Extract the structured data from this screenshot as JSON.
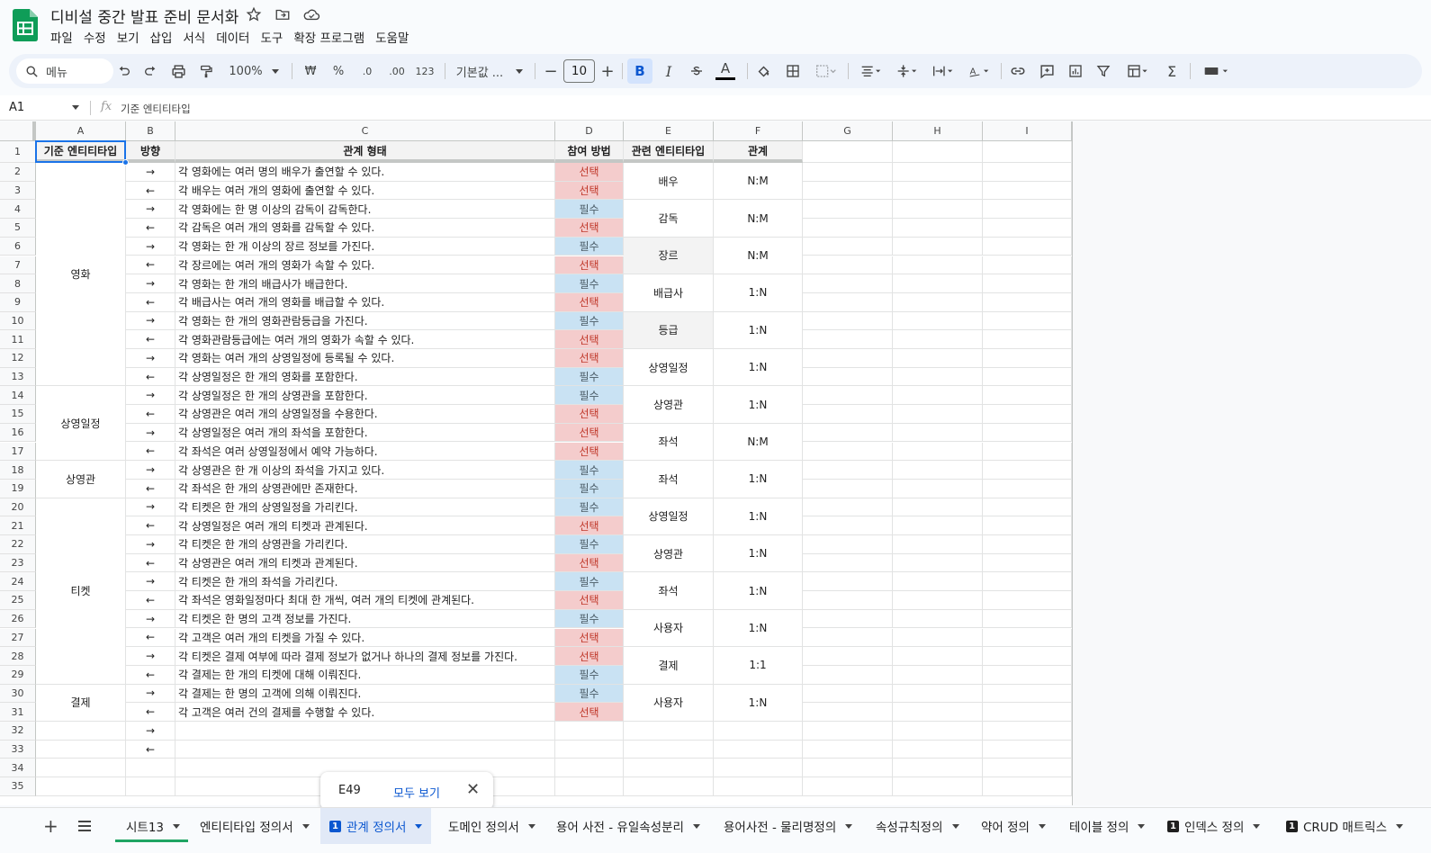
{
  "app": {
    "doc_title": "디비설 중간 발표 준비 문서화",
    "menu": [
      "파일",
      "수정",
      "보기",
      "삽입",
      "서식",
      "데이터",
      "도구",
      "확장 프로그램",
      "도움말"
    ]
  },
  "toolbar": {
    "search_label": "메뉴",
    "zoom": "100%",
    "currency": "₩",
    "percent": "%",
    "decimal_less": ".0",
    "decimal_more": ".00",
    "number_format": "123",
    "font": "기본값 ...",
    "font_size": "10",
    "bold": "B",
    "italic": "I",
    "text_color": "A"
  },
  "formula_bar": {
    "cell_ref": "A1",
    "fx": "fx",
    "content": "기준 엔티티타입"
  },
  "columns": [
    "A",
    "B",
    "C",
    "D",
    "E",
    "F",
    "G",
    "H",
    "I"
  ],
  "rows": [
    "1",
    "2",
    "3",
    "4",
    "5",
    "6",
    "7",
    "8",
    "9",
    "10",
    "11",
    "12",
    "13",
    "14",
    "15",
    "16",
    "17",
    "18",
    "19",
    "20",
    "21",
    "22",
    "23",
    "24",
    "25",
    "26",
    "27",
    "28",
    "29",
    "30",
    "31",
    "32",
    "33",
    "34",
    "35"
  ],
  "header": [
    "기준 엔티티타입",
    "방향",
    "관계 형태",
    "참여 방법",
    "관련 엔티티타입",
    "관계"
  ],
  "entity_groups": [
    {
      "name": "영화",
      "start": 2,
      "end": 13
    },
    {
      "name": "상영일정",
      "start": 14,
      "end": 17
    },
    {
      "name": "상영관",
      "start": 18,
      "end": 19
    },
    {
      "name": "티켓",
      "start": 20,
      "end": 29
    },
    {
      "name": "결제",
      "start": 30,
      "end": 31
    }
  ],
  "relation_rows": [
    {
      "dir": "→",
      "text": "각 영화에는 여러 명의 배우가 출연할 수 있다.",
      "part": "선택",
      "type": "opt"
    },
    {
      "dir": "←",
      "text": "각 배우는 여러 개의 영화에 출연할 수 있다.",
      "part": "선택",
      "type": "opt"
    },
    {
      "dir": "→",
      "text": "각 영화에는 한 명 이상의 감독이 감독한다.",
      "part": "필수",
      "type": "req"
    },
    {
      "dir": "←",
      "text": "각 감독은 여러 개의 영화를 감독할 수 있다.",
      "part": "선택",
      "type": "opt"
    },
    {
      "dir": "→",
      "text": "각 영화는 한 개 이상의 장르 정보를 가진다.",
      "part": "필수",
      "type": "req"
    },
    {
      "dir": "←",
      "text": "각 장르에는 여러 개의 영화가 속할 수 있다.",
      "part": "선택",
      "type": "opt"
    },
    {
      "dir": "→",
      "text": "각 영화는 한 개의 배급사가 배급한다.",
      "part": "필수",
      "type": "req"
    },
    {
      "dir": "←",
      "text": "각 배급사는 여러 개의 영화를 배급할 수 있다.",
      "part": "선택",
      "type": "opt"
    },
    {
      "dir": "→",
      "text": "각 영화는 한 개의 영화관람등급을 가진다.",
      "part": "필수",
      "type": "req"
    },
    {
      "dir": "←",
      "text": "각 영화관람등급에는 여러 개의 영화가 속할 수 있다.",
      "part": "선택",
      "type": "opt"
    },
    {
      "dir": "→",
      "text": "각 영화는 여러 개의 상영일정에 등록될 수 있다.",
      "part": "선택",
      "type": "opt"
    },
    {
      "dir": "←",
      "text": "각 상영일정은 한 개의 영화를 포함한다.",
      "part": "필수",
      "type": "req"
    },
    {
      "dir": "→",
      "text": "각 상영일정은 한 개의 상영관을 포함한다.",
      "part": "필수",
      "type": "req"
    },
    {
      "dir": "←",
      "text": "각 상영관은 여러 개의 상영일정을 수용한다.",
      "part": "선택",
      "type": "opt"
    },
    {
      "dir": "→",
      "text": "각 상영일정은 여러 개의 좌석을 포함한다.",
      "part": "선택",
      "type": "opt"
    },
    {
      "dir": "←",
      "text": "각 좌석은 여러 상영일정에서 예약 가능하다.",
      "part": "선택",
      "type": "opt"
    },
    {
      "dir": "→",
      "text": "각 상영관은 한 개 이상의 좌석을 가지고 있다.",
      "part": "필수",
      "type": "req"
    },
    {
      "dir": "←",
      "text": "각 좌석은 한 개의 상영관에만 존재한다.",
      "part": "필수",
      "type": "req"
    },
    {
      "dir": "→",
      "text": "각 티켓은 한 개의 상영일정을 가리킨다.",
      "part": "필수",
      "type": "req"
    },
    {
      "dir": "←",
      "text": "각 상영일정은 여러 개의 티켓과 관계된다.",
      "part": "선택",
      "type": "opt"
    },
    {
      "dir": "→",
      "text": "각 티켓은 한 개의 상영관을 가리킨다.",
      "part": "필수",
      "type": "req"
    },
    {
      "dir": "←",
      "text": "각 상영관은 여러 개의 티켓과 관계된다.",
      "part": "선택",
      "type": "opt"
    },
    {
      "dir": "→",
      "text": "각 티켓은 한 개의 좌석을 가리킨다.",
      "part": "필수",
      "type": "req"
    },
    {
      "dir": "←",
      "text": "각 좌석은 영화일정마다 최대 한 개씩, 여러 개의 티켓에 관계된다.",
      "part": "선택",
      "type": "opt"
    },
    {
      "dir": "→",
      "text": "각 티켓은 한 명의 고객 정보를 가진다.",
      "part": "필수",
      "type": "req"
    },
    {
      "dir": "←",
      "text": "각 고객은 여러 개의 티켓을 가질 수 있다.",
      "part": "선택",
      "type": "opt"
    },
    {
      "dir": "→",
      "text": "각 티켓은 결제 여부에 따라 결제 정보가 없거나 하나의 결제 정보를 가진다.",
      "part": "선택",
      "type": "opt"
    },
    {
      "dir": "←",
      "text": "각 결제는 한 개의 티켓에 대해 이뤄진다.",
      "part": "필수",
      "type": "req"
    },
    {
      "dir": "→",
      "text": "각 결제는 한 명의 고객에 의해 이뤄진다.",
      "part": "필수",
      "type": "req"
    },
    {
      "dir": "←",
      "text": "각 고객은 여러 건의 결제를 수행할 수 있다.",
      "part": "선택",
      "type": "opt"
    },
    {
      "dir": "→",
      "text": "",
      "part": "",
      "type": "none"
    },
    {
      "dir": "←",
      "text": "",
      "part": "",
      "type": "none"
    }
  ],
  "related_pairs": [
    {
      "entity": "배우",
      "rel": "N:M",
      "gray": false
    },
    {
      "entity": "감독",
      "rel": "N:M",
      "gray": false
    },
    {
      "entity": "장르",
      "rel": "N:M",
      "gray": true
    },
    {
      "entity": "배급사",
      "rel": "1:N",
      "gray": false
    },
    {
      "entity": "등급",
      "rel": "1:N",
      "gray": true
    },
    {
      "entity": "상영일정",
      "rel": "1:N",
      "gray": false
    },
    {
      "entity": "상영관",
      "rel": "1:N",
      "gray": false
    },
    {
      "entity": "좌석",
      "rel": "N:M",
      "gray": false
    },
    {
      "entity": "좌석",
      "rel": "1:N",
      "gray": false
    },
    {
      "entity": "상영일정",
      "rel": "1:N",
      "gray": false
    },
    {
      "entity": "상영관",
      "rel": "1:N",
      "gray": false
    },
    {
      "entity": "좌석",
      "rel": "1:N",
      "gray": false
    },
    {
      "entity": "사용자",
      "rel": "1:N",
      "gray": false
    },
    {
      "entity": "결제",
      "rel": "1:1",
      "gray": false
    },
    {
      "entity": "사용자",
      "rel": "1:N",
      "gray": false
    }
  ],
  "popup": {
    "ref": "E49",
    "action": "모두 보기",
    "close": "✕"
  },
  "sheet_tabs": [
    {
      "label": "시트13",
      "num": "",
      "active": false
    },
    {
      "label": "엔티티타입 정의서",
      "num": "",
      "active": false
    },
    {
      "label": "관계 정의서",
      "num": "1",
      "active": true
    },
    {
      "label": "도메인 정의서",
      "num": "",
      "active": false
    },
    {
      "label": "용어 사전 - 유일속성분리",
      "num": "",
      "active": false
    },
    {
      "label": "용어사전 - 물리명정의",
      "num": "",
      "active": false
    },
    {
      "label": "속성규칙정의",
      "num": "",
      "active": false
    },
    {
      "label": "약어 정의",
      "num": "",
      "active": false
    },
    {
      "label": "테이블 정의",
      "num": "",
      "active": false
    },
    {
      "label": "인덱스 정의",
      "num": "1",
      "active": false
    },
    {
      "label": "CRUD 매트릭스",
      "num": "1",
      "active": false
    }
  ],
  "colors": {
    "required_bg": "#c9e2f3",
    "optional_bg": "#f4cccc",
    "accent": "#0b57d0",
    "logo": "#0f9d58"
  }
}
